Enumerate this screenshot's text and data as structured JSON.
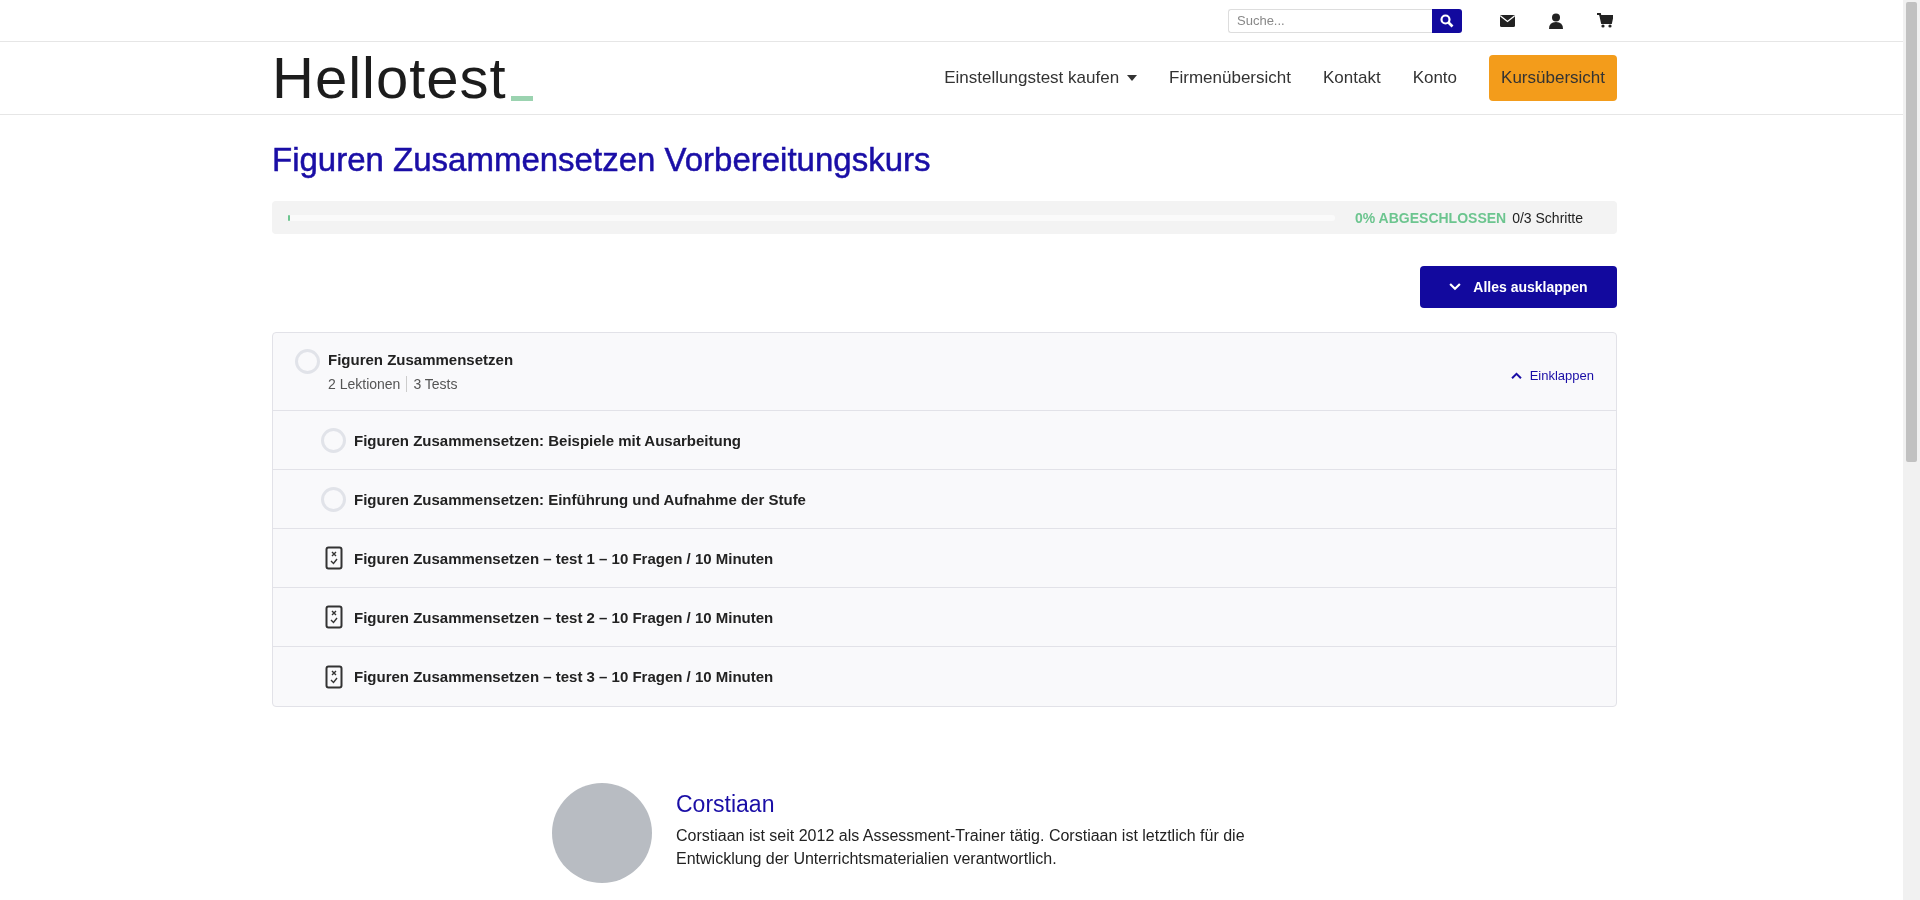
{
  "topbar": {
    "search": {
      "placeholder": "Suche..."
    }
  },
  "logo": {
    "text": "Hellotest"
  },
  "nav": [
    {
      "label": "Einstellungstest kaufen",
      "dropdown": true,
      "highlighted": false
    },
    {
      "label": "Firmenübersicht",
      "dropdown": false,
      "highlighted": false
    },
    {
      "label": "Kontakt",
      "dropdown": false,
      "highlighted": false
    },
    {
      "label": "Konto",
      "dropdown": false,
      "highlighted": false
    },
    {
      "label": "Kursübersicht",
      "dropdown": false,
      "highlighted": true
    }
  ],
  "course": {
    "title": "Figuren Zusammensetzen Vorbereitungskurs",
    "progress": {
      "level": 0,
      "percent": "0% ABGESCHLOSSEN",
      "steps": "0/3 Schritte"
    },
    "expand_all": "Alles ausklappen",
    "sections": [
      {
        "title": "Figuren Zusammensetzen",
        "completed": false,
        "lessons": "2 Lektionen",
        "tests": "3 Tests",
        "expanded": true,
        "toggle": "Einklappen",
        "items": [
          {
            "kind": "lesson",
            "title": "Figuren Zusammensetzen: Beispiele mit Ausarbeitung",
            "completed": false
          },
          {
            "kind": "lesson",
            "title": "Figuren Zusammensetzen: Einführung und Aufnahme der Stufe",
            "completed": false
          },
          {
            "kind": "test",
            "title": "Figuren Zusammensetzen – test 1 – 10 Fragen / 10 Minuten",
            "completed": false
          },
          {
            "kind": "test",
            "title": "Figuren Zusammensetzen – test 2 – 10 Fragen / 10 Minuten",
            "completed": false
          },
          {
            "kind": "test",
            "title": "Figuren Zusammensetzen – test 3 – 10 Fragen / 10 Minuten",
            "completed": false
          }
        ]
      }
    ]
  },
  "author": {
    "name": "Corstiaan",
    "bio": "Corstiaan ist seit 2012 als Assessment-Trainer tätig. Corstiaan ist letztlich für die Entwicklung der Unterrichtsmaterialien verantwortlich."
  }
}
